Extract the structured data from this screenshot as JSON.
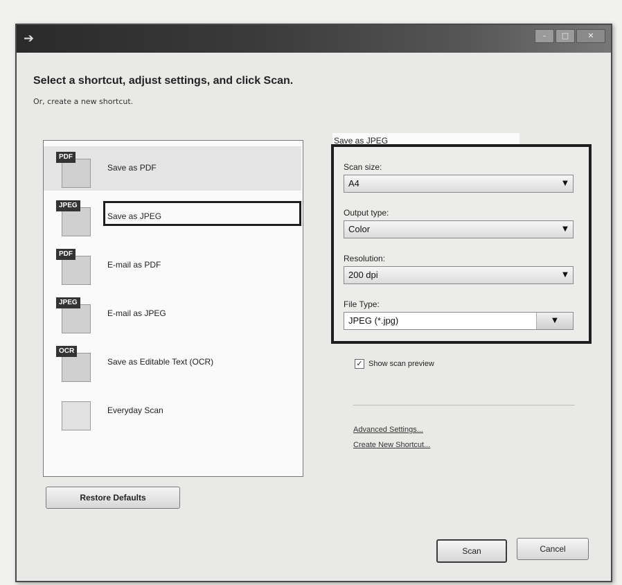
{
  "window": {
    "heading": "Select a shortcut, adjust settings, and click Scan.",
    "subheading": "Or, create a new shortcut."
  },
  "shortcuts": [
    {
      "tag": "PDF",
      "label": "Save as PDF"
    },
    {
      "tag": "JPEG",
      "label": "Save as JPEG"
    },
    {
      "tag": "PDF",
      "label": "E-mail as PDF"
    },
    {
      "tag": "JPEG",
      "label": "E-mail as JPEG"
    },
    {
      "tag": "OCR",
      "label": "Save as Editable Text (OCR)"
    },
    {
      "tag": "",
      "label": "Everyday Scan"
    }
  ],
  "selected_shortcut": "Save as JPEG",
  "restore_defaults_label": "Restore Defaults",
  "settings": {
    "title": "Save as JPEG",
    "scan_size_label": "Scan size:",
    "scan_size_value": "A4",
    "output_type_label": "Output type:",
    "output_type_value": "Color",
    "resolution_label": "Resolution:",
    "resolution_value": "200 dpi",
    "file_type_label": "File Type:",
    "file_type_value": "JPEG (*.jpg)",
    "show_preview_label": "Show scan preview",
    "show_preview_checked": true
  },
  "links": {
    "advanced": "Advanced Settings...",
    "create_new": "Create New Shortcut..."
  },
  "buttons": {
    "scan": "Scan",
    "cancel": "Cancel"
  }
}
